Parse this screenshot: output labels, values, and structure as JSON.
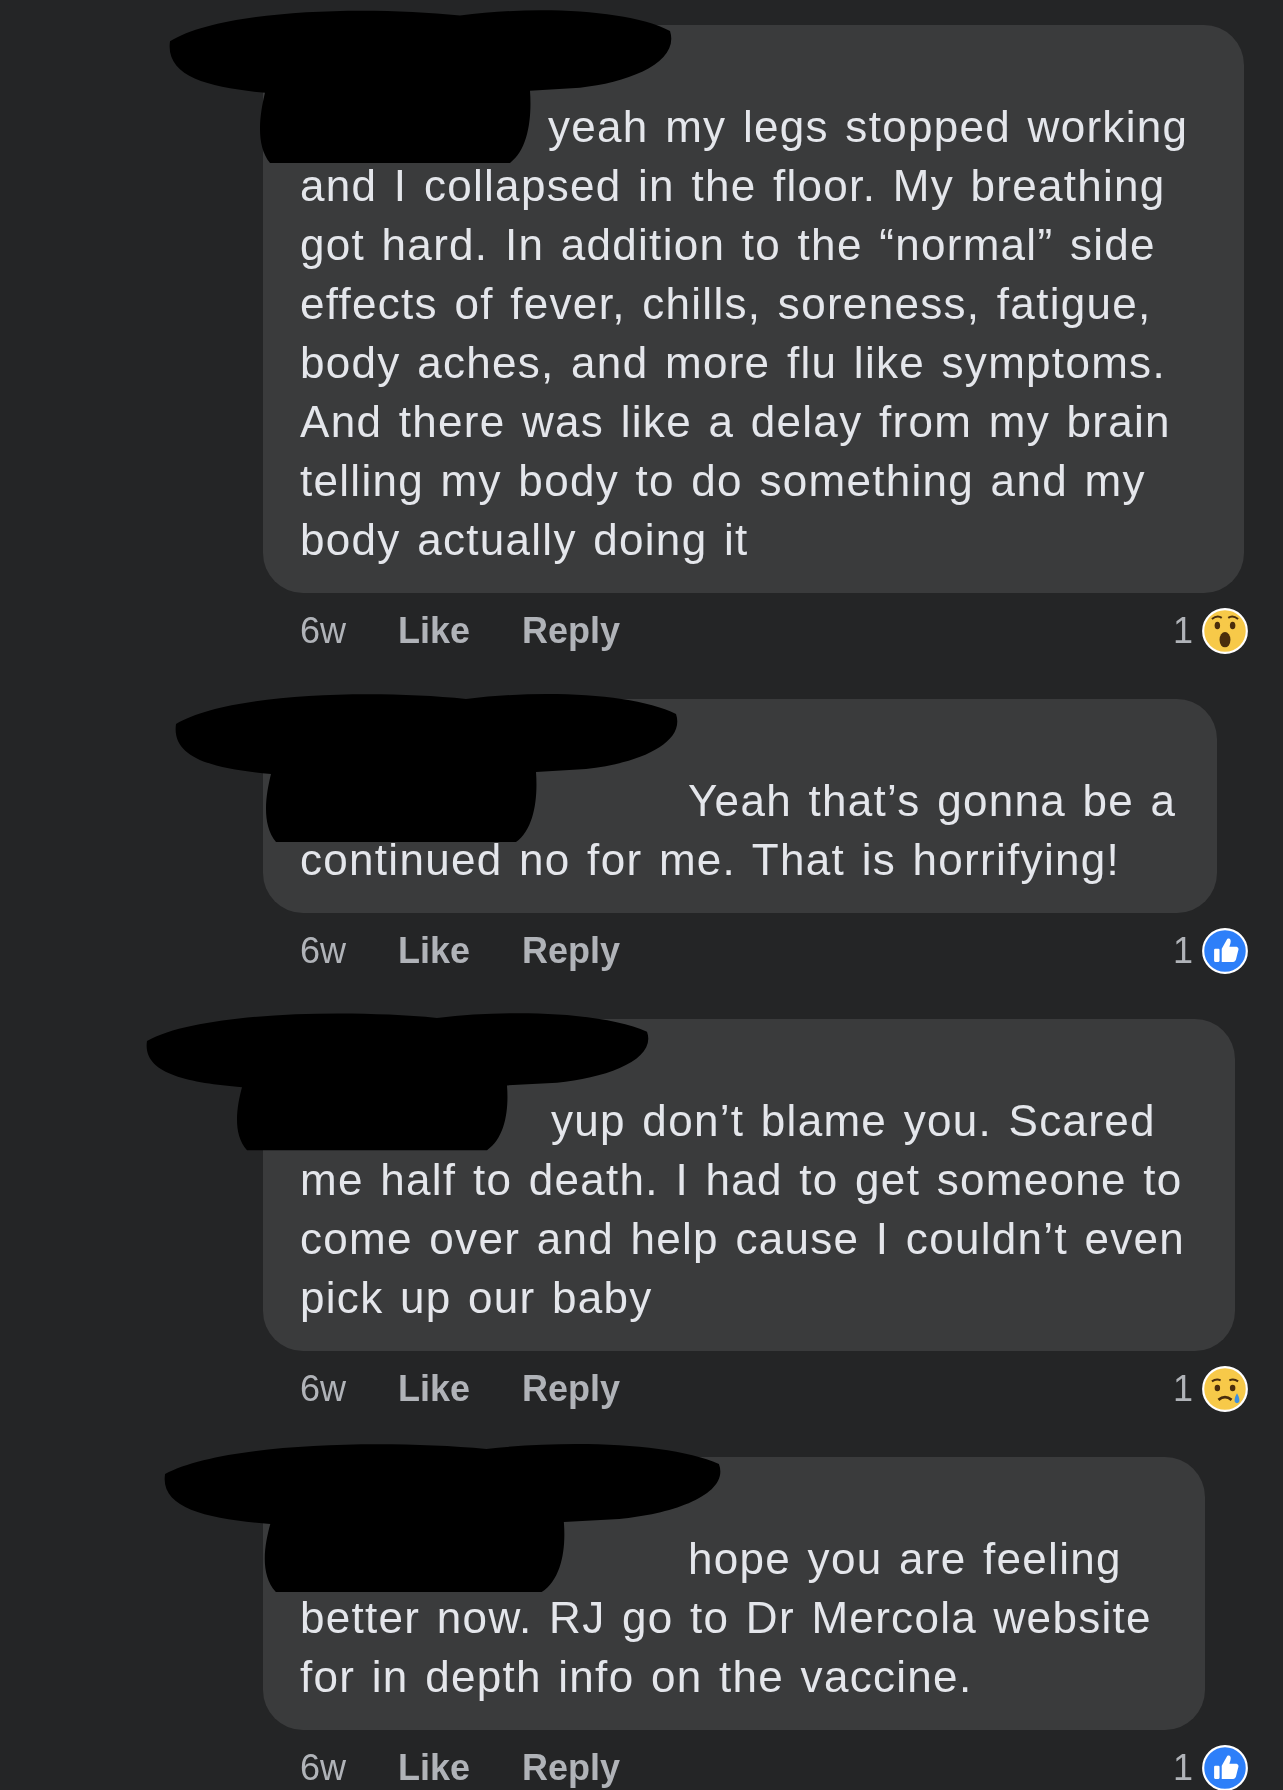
{
  "comments": [
    {
      "text": "yeah my legs stopped working and I collapsed in the floor. My breathing got hard. In addition to the “normal” side effects of fever, chills, soreness, fatigue, body aches, and more flu like symptoms. And there was like a delay from my brain telling my body to do something and my body actually doing it",
      "time": "6w",
      "like": "Like",
      "reply": "Reply",
      "reaction": {
        "count": "1",
        "kind": "wow"
      }
    },
    {
      "text": "Yeah that’s gonna be a continued no for me. That is horrifying!",
      "time": "6w",
      "like": "Like",
      "reply": "Reply",
      "reaction": {
        "count": "1",
        "kind": "like"
      }
    },
    {
      "text": "yup don’t blame you. Scared me half to death. I had to get someone to come over and help cause I couldn’t even pick up our baby",
      "time": "6w",
      "like": "Like",
      "reply": "Reply",
      "reaction": {
        "count": "1",
        "kind": "sad"
      }
    },
    {
      "text": "hope you are feeling better now. RJ go to Dr Mercola website for in depth info on the vaccine.",
      "time": "6w",
      "like": "Like",
      "reply": "Reply",
      "reaction": {
        "count": "1",
        "kind": "like"
      }
    }
  ]
}
